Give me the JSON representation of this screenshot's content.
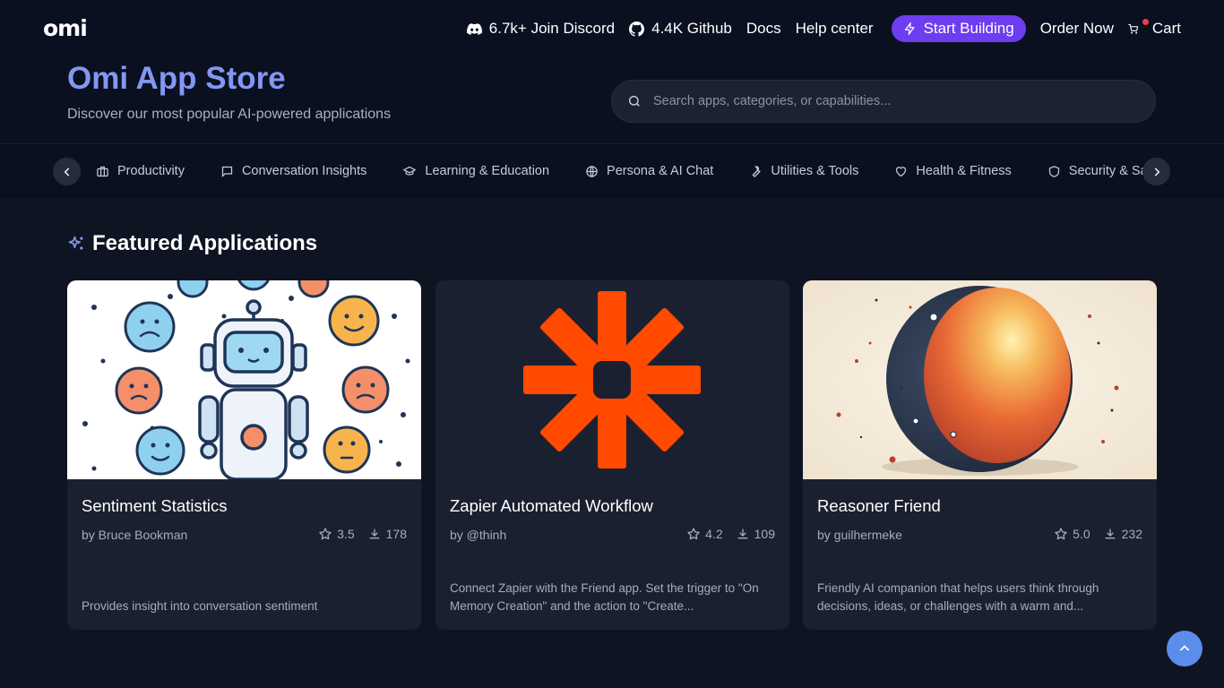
{
  "nav": {
    "logo": "omi",
    "discord": "6.7k+ Join Discord",
    "github": "4.4K Github",
    "docs": "Docs",
    "help": "Help center",
    "start_building": "Start Building",
    "order_now": "Order Now",
    "cart": "Cart"
  },
  "hero": {
    "title": "Omi App Store",
    "subtitle": "Discover our most popular AI-powered applications",
    "search_placeholder": "Search apps, categories, or capabilities..."
  },
  "categories": [
    {
      "label": "Productivity",
      "icon": "briefcase-icon"
    },
    {
      "label": "Conversation Insights",
      "icon": "message-square-icon"
    },
    {
      "label": "Learning & Education",
      "icon": "graduation-cap-icon"
    },
    {
      "label": "Persona & AI Chat",
      "icon": "globe-icon"
    },
    {
      "label": "Utilities & Tools",
      "icon": "wrench-icon"
    },
    {
      "label": "Health & Fitness",
      "icon": "heart-icon"
    },
    {
      "label": "Security & Safety",
      "icon": "shield-icon"
    }
  ],
  "featured": {
    "title": "Featured Applications",
    "apps": [
      {
        "name": "Sentiment Statistics",
        "author": "by Bruce Bookman",
        "rating": "3.5",
        "downloads": "178",
        "description": "Provides insight into conversation sentiment",
        "image": "robot-with-emoji-faces"
      },
      {
        "name": "Zapier Automated Workflow",
        "author": "by @thinh",
        "rating": "4.2",
        "downloads": "109",
        "description": "Connect Zapier with the Friend app. Set the trigger to \"On Memory Creation\" and the action to \"Create...",
        "image": "zapier-asterisk-logo"
      },
      {
        "name": "Reasoner Friend",
        "author": "by guilhermeke",
        "rating": "5.0",
        "downloads": "232",
        "description": "Friendly AI companion that helps users think through decisions, ideas, or challenges with a warm and...",
        "image": "orange-sphere"
      }
    ]
  },
  "colors": {
    "background": "#0f1423",
    "header_bg": "#0b1020",
    "accent_purple": "#6d3df0",
    "title_blue": "#8397f2",
    "card_bg": "#1b2030",
    "scroll_button": "#5b8ded",
    "zapier_orange": "#ff4a00"
  }
}
